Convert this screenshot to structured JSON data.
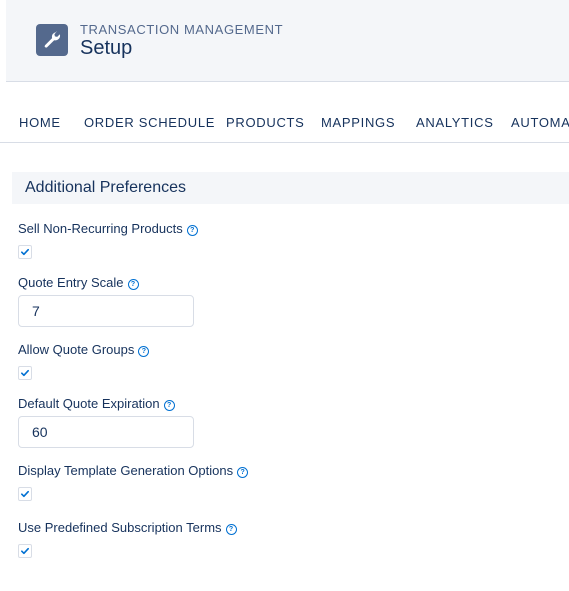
{
  "header": {
    "label": "TRANSACTION MANAGEMENT",
    "title": "Setup",
    "icon": "wrench-icon"
  },
  "tabs": [
    {
      "label": "HOME"
    },
    {
      "label": "ORDER SCHEDULE"
    },
    {
      "label": "PRODUCTS"
    },
    {
      "label": "MAPPINGS"
    },
    {
      "label": "ANALYTICS"
    },
    {
      "label": "AUTOMATION"
    }
  ],
  "section": {
    "title": "Additional Preferences"
  },
  "fields": {
    "sell_non_recurring": {
      "label": "Sell Non-Recurring Products",
      "checked": true
    },
    "quote_entry_scale": {
      "label": "Quote Entry Scale",
      "value": "7"
    },
    "allow_quote_groups": {
      "label": "Allow Quote Groups",
      "checked": true
    },
    "default_quote_expiration": {
      "label": "Default Quote Expiration",
      "value": "60"
    },
    "display_template_generation": {
      "label": "Display Template Generation Options",
      "checked": true
    },
    "use_predefined_subscription_terms": {
      "label": "Use Predefined Subscription Terms",
      "checked": true
    }
  },
  "help_glyph": "?",
  "colors": {
    "accent": "#0070d2",
    "text": "#16325c",
    "header_bg": "#f4f6f9",
    "icon_bg": "#54698d"
  }
}
